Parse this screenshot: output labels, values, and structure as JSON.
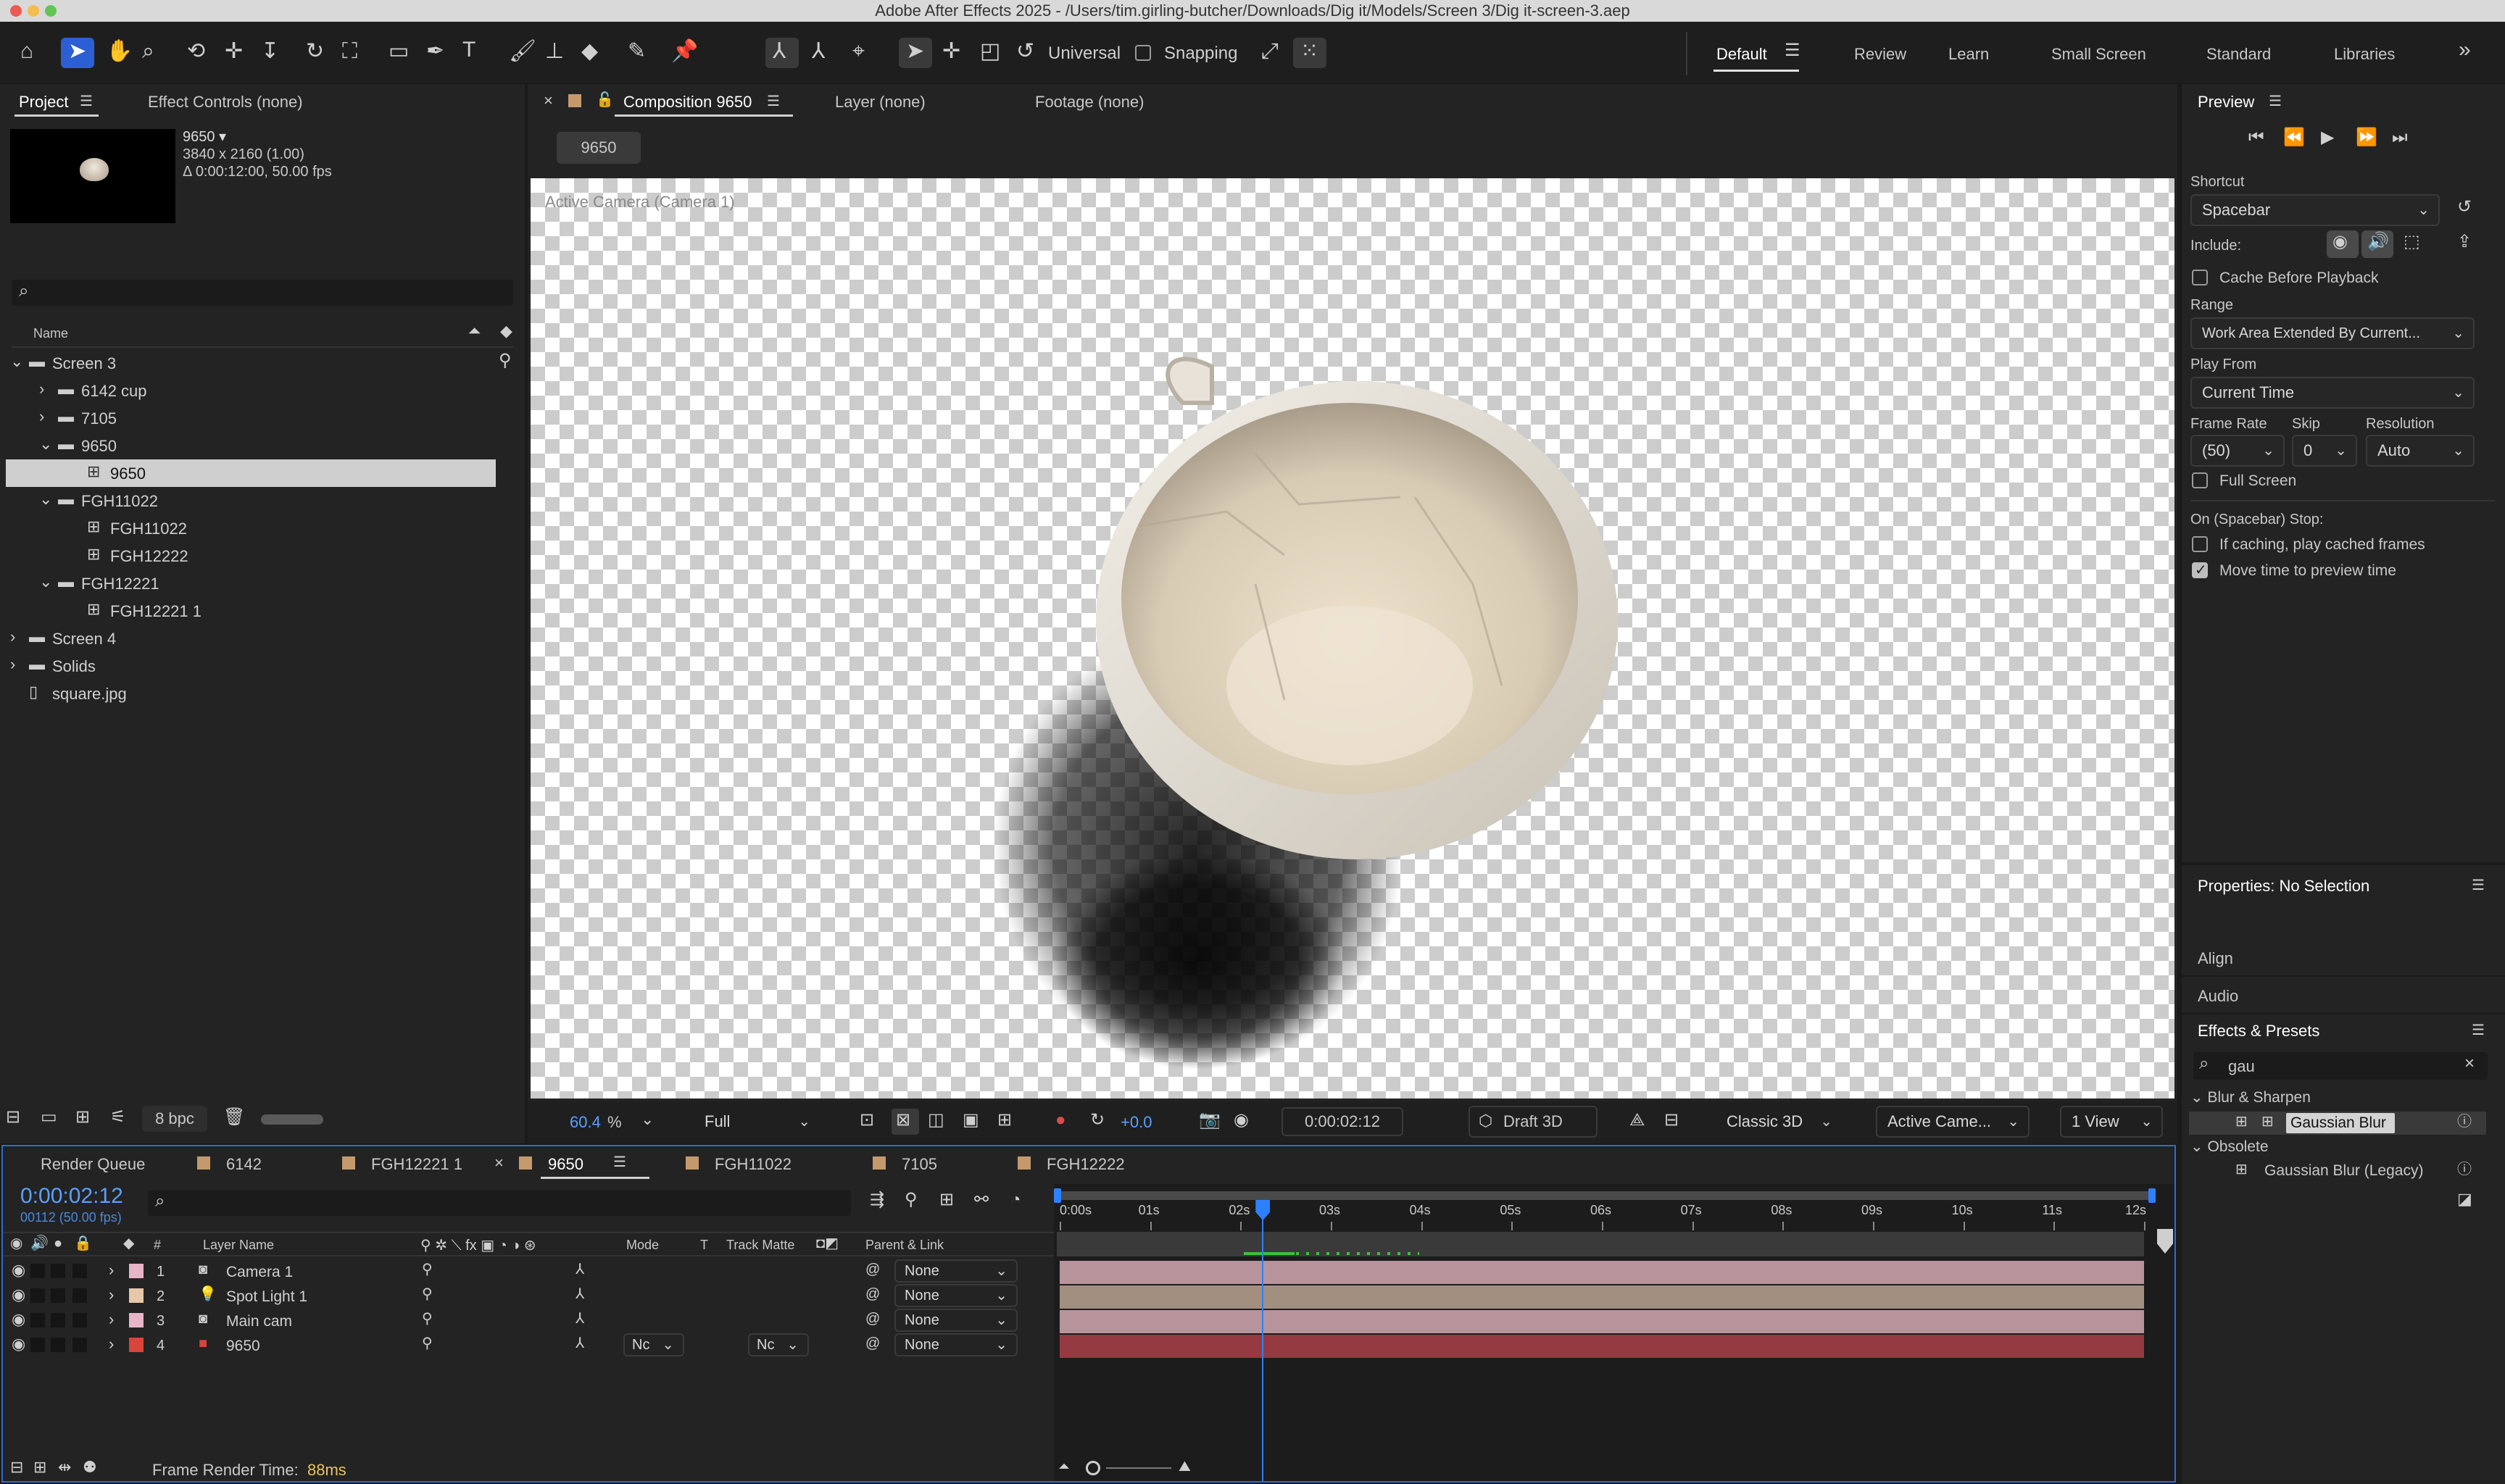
{
  "titlebar": {
    "title": "Adobe After Effects 2025 - /Users/tim.girling-butcher/Downloads/Dig it/Models/Screen 3/Dig it-screen-3.aep"
  },
  "toolbar": {
    "universal": "Universal",
    "snapping": "Snapping"
  },
  "workspaces": [
    "Default",
    "Review",
    "Learn",
    "Small Screen",
    "Standard",
    "Libraries"
  ],
  "project": {
    "tab": "Project",
    "effect_controls_tab": "Effect Controls (none)",
    "thumb_name": "9650 ▾",
    "thumb_info1": "3840 x 2160 (1.00)",
    "thumb_info2": "Δ 0:00:12:00, 50.00 fps",
    "col_name": "Name",
    "items": [
      {
        "label": "Screen 3",
        "indent": 0,
        "kind": "folder",
        "open": true
      },
      {
        "label": "6142 cup",
        "indent": 1,
        "kind": "folder",
        "open": false
      },
      {
        "label": "7105",
        "indent": 1,
        "kind": "folder",
        "open": false
      },
      {
        "label": "9650",
        "indent": 1,
        "kind": "folder",
        "open": true
      },
      {
        "label": "9650",
        "indent": 2,
        "kind": "comp",
        "selected": true
      },
      {
        "label": "FGH11022",
        "indent": 1,
        "kind": "folder",
        "open": true
      },
      {
        "label": "FGH11022",
        "indent": 2,
        "kind": "comp"
      },
      {
        "label": "FGH12222",
        "indent": 2,
        "kind": "comp"
      },
      {
        "label": "FGH12221",
        "indent": 1,
        "kind": "folder",
        "open": true
      },
      {
        "label": "FGH12221 1",
        "indent": 2,
        "kind": "comp"
      },
      {
        "label": "Screen 4",
        "indent": 0,
        "kind": "folder",
        "open": false
      },
      {
        "label": "Solids",
        "indent": 0,
        "kind": "folder",
        "open": false
      },
      {
        "label": "square.jpg",
        "indent": 0,
        "kind": "file"
      }
    ],
    "bpc": "8 bpc"
  },
  "comp": {
    "tab": "Composition 9650",
    "layer_tab": "Layer (none)",
    "footage_tab": "Footage (none)",
    "breadcrumb": "9650",
    "camera_label": "Active Camera (Camera 1)",
    "zoom": "60.4",
    "zoom_unit": "%",
    "resolution": "Full",
    "exposure": "+0.0",
    "timecode": "0:00:02:12",
    "draft": "Draft 3D",
    "renderer": "Classic 3D",
    "camera": "Active Came...",
    "view": "1 View"
  },
  "preview": {
    "title": "Preview",
    "shortcut_label": "Shortcut",
    "shortcut": "Spacebar",
    "include_label": "Include:",
    "cache_label": "Cache Before Playback",
    "range_label": "Range",
    "range": "Work Area Extended By Current...",
    "playfrom_label": "Play From",
    "playfrom": "Current Time",
    "framerate_label": "Frame Rate",
    "skip_label": "Skip",
    "resolution_label": "Resolution",
    "framerate": "(50)",
    "skip": "0",
    "resolution": "Auto",
    "fullscreen_label": "Full Screen",
    "stop_label": "On (Spacebar) Stop:",
    "caching_label": "If caching, play cached frames",
    "movetime_label": "Move time to preview time"
  },
  "properties": {
    "title": "Properties: No Selection",
    "align": "Align",
    "audio": "Audio"
  },
  "effects": {
    "title": "Effects & Presets",
    "search": "gau",
    "cat1": "Blur & Sharpen",
    "item1": "Gaussian Blur",
    "cat2": "Obsolete",
    "item2": "Gaussian Blur (Legacy)"
  },
  "timeline": {
    "tabs": [
      {
        "label": "Render Queue",
        "color": ""
      },
      {
        "label": "6142",
        "color": "#c49a6c"
      },
      {
        "label": "FGH12221 1",
        "color": "#c49a6c"
      },
      {
        "label": "9650",
        "color": "#c49a6c",
        "active": true
      },
      {
        "label": "FGH11022",
        "color": "#c49a6c"
      },
      {
        "label": "7105",
        "color": "#c49a6c"
      },
      {
        "label": "FGH12222",
        "color": "#c49a6c"
      }
    ],
    "timecode": "0:00:02:12",
    "frames": "00112 (50.00 fps)",
    "col_num": "#",
    "col_layer": "Layer Name",
    "col_mode": "Mode",
    "col_t": "T",
    "col_matte": "Track Matte",
    "col_parent": "Parent & Link",
    "ruler": [
      "0:00s",
      "01s",
      "02s",
      "03s",
      "04s",
      "05s",
      "06s",
      "07s",
      "08s",
      "09s",
      "10s",
      "11s",
      "12s"
    ],
    "playhead_sec": 2.24,
    "duration_sec": 12,
    "layers": [
      {
        "num": "1",
        "name": "Camera 1",
        "color": "#e8b4c8",
        "icon": "camera-icon",
        "glyph": "◙",
        "parent": "None",
        "bar": "#b7939b"
      },
      {
        "num": "2",
        "name": "Spot Light 1",
        "color": "#e6c7a8",
        "icon": "light-icon",
        "glyph": "💡",
        "parent": "None",
        "bar": "#a38f7f"
      },
      {
        "num": "3",
        "name": "Main cam",
        "color": "#e8b4c8",
        "icon": "camera-icon",
        "glyph": "◙",
        "parent": "None",
        "bar": "#b7939b"
      },
      {
        "num": "4",
        "name": "9650",
        "color": "#d8453b",
        "icon": "comp-icon",
        "glyph": "■",
        "parent": "None",
        "bar": "#943a40",
        "mode": "Nc",
        "matte": "Nc"
      }
    ],
    "render_label": "Frame Render Time:",
    "render_time": "88ms"
  }
}
